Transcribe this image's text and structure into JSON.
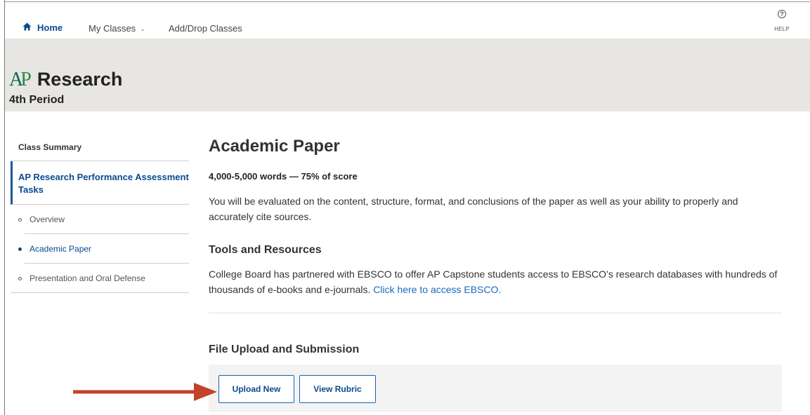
{
  "nav": {
    "home_label": "Home",
    "my_classes_label": "My Classes",
    "add_drop_label": "Add/Drop Classes",
    "help_glyph": "?",
    "help_label": "HELP",
    "icons": [
      "home-icon",
      "chevron-down-icon",
      "help-icon"
    ]
  },
  "banner": {
    "logo_a": "A",
    "logo_p": "P",
    "course_name": "Research",
    "period": "4th Period"
  },
  "sidebar": {
    "summary_label": "Class Summary",
    "tasks_label": "AP Research Performance Assessment Tasks",
    "items": [
      {
        "label": "Overview",
        "active": false
      },
      {
        "label": "Academic Paper",
        "active": true
      },
      {
        "label": "Presentation and Oral Defense",
        "active": false
      }
    ]
  },
  "main": {
    "title": "Academic Paper",
    "word_count": "4,000-5,000 words — 75% of score",
    "description": "You will be evaluated on the content, structure, format, and conclusions of the paper as well as your ability to properly and accurately cite sources.",
    "tools_heading": "Tools and Resources",
    "tools_text": "College Board has partnered with EBSCO to offer AP Capstone students access to EBSCO’s research databases with hundreds of thousands of e-books and e-journals. ",
    "tools_link": "Click here to access EBSCO.",
    "upload_heading": "File Upload and Submission",
    "upload_button": "Upload New",
    "rubric_button": "View Rubric"
  },
  "colors": {
    "link": "#0a4a8f",
    "banner_bg": "#e8e6e2",
    "annotation_arrow": "#c0432a"
  }
}
